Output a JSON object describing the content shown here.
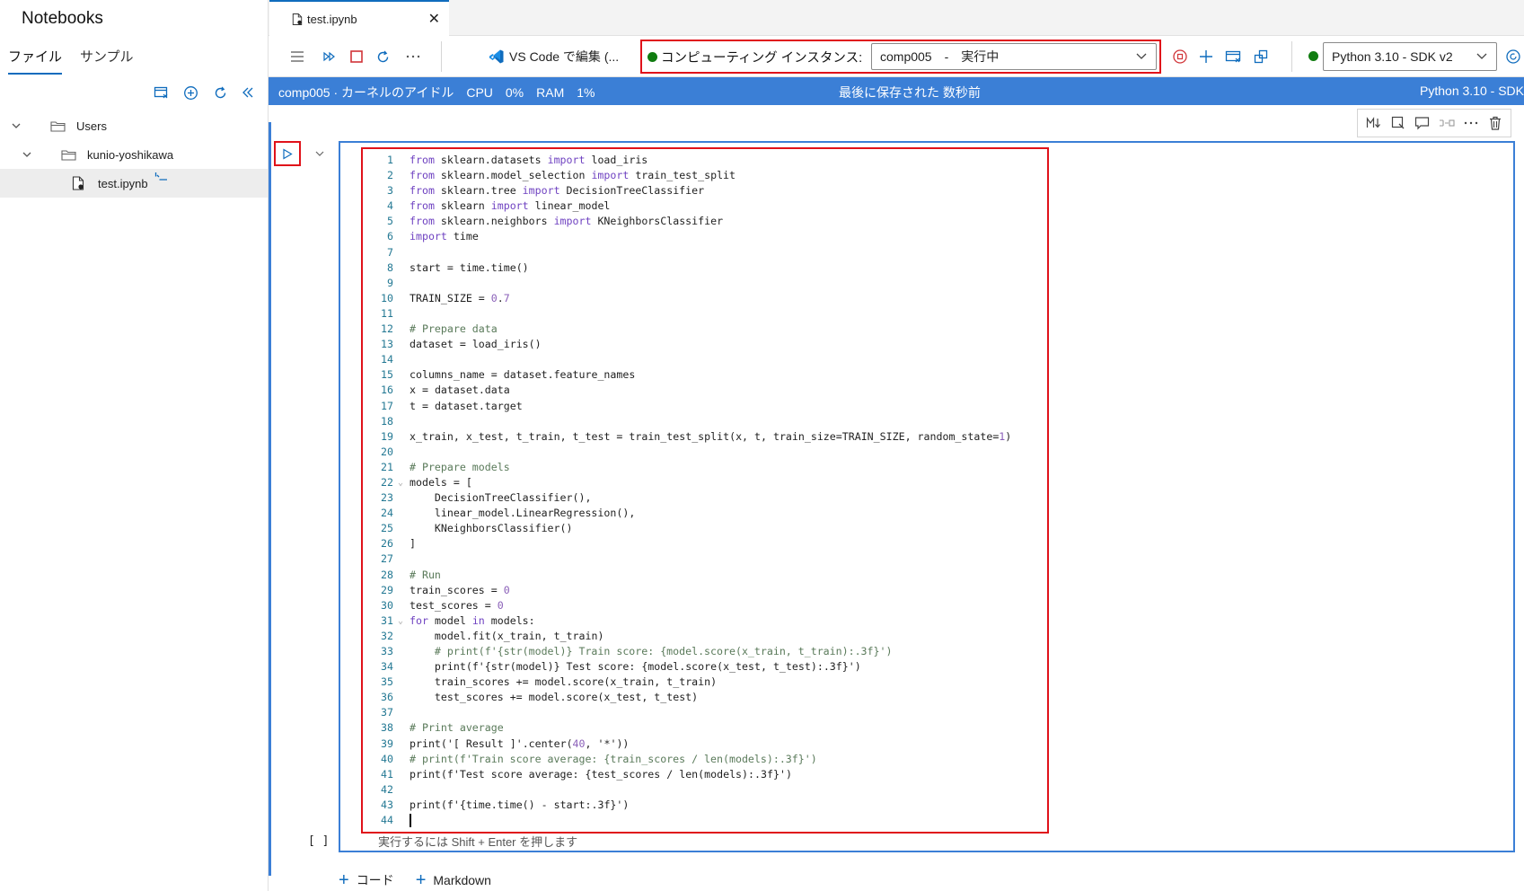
{
  "left_panel": {
    "title": "Notebooks",
    "tabs": [
      {
        "label": "ファイル",
        "active": true
      },
      {
        "label": "サンプル",
        "active": false
      }
    ],
    "tools": [
      "new-file-icon",
      "add-icon",
      "refresh-icon",
      "collapse-panel-icon"
    ],
    "tree": [
      {
        "label": "Users",
        "type": "folder",
        "expanded": true
      },
      {
        "label": "kunio-yoshikawa",
        "type": "folder",
        "expanded": true
      },
      {
        "label": "test.ipynb",
        "type": "notebook",
        "selected": true
      }
    ]
  },
  "tab_strip": {
    "file_tab_label": "test.ipynb",
    "close_glyph": "✕"
  },
  "toolbar": {
    "vscode_label": "VS Code で編集 (...",
    "compute_label": "コンピューティング インスタンス:",
    "compute_value": "comp005　-　実行中",
    "kernel_value": "Python 3.10 - SDK v2",
    "status_color": "#107c10"
  },
  "status_bar": {
    "left": "comp005 · カーネルのアイドル　CPU　0%　RAM　1%",
    "center": "最後に保存された 数秒前",
    "right": "Python 3.10 - SDK"
  },
  "cell": {
    "execution_count": "[ ]",
    "hint": "実行するには Shift + Enter を押します",
    "code_lines": [
      "from sklearn.datasets import load_iris",
      "from sklearn.model_selection import train_test_split",
      "from sklearn.tree import DecisionTreeClassifier",
      "from sklearn import linear_model",
      "from sklearn.neighbors import KNeighborsClassifier",
      "import time",
      "",
      "start = time.time()",
      "",
      "TRAIN_SIZE = 0.7",
      "",
      "# Prepare data",
      "dataset = load_iris()",
      "",
      "columns_name = dataset.feature_names",
      "x = dataset.data",
      "t = dataset.target",
      "",
      "x_train, x_test, t_train, t_test = train_test_split(x, t, train_size=TRAIN_SIZE, random_state=1)",
      "",
      "# Prepare models",
      "models = [",
      "    DecisionTreeClassifier(),",
      "    linear_model.LinearRegression(),",
      "    KNeighborsClassifier()",
      "]",
      "",
      "# Run",
      "train_scores = 0",
      "test_scores = 0",
      "for model in models:",
      "    model.fit(x_train, t_train)",
      "    # print(f'{str(model)} Train score: {model.score(x_train, t_train):.3f}')",
      "    print(f'{str(model)} Test score: {model.score(x_test, t_test):.3f}')",
      "    train_scores += model.score(x_train, t_train)",
      "    test_scores += model.score(x_test, t_test)",
      "",
      "# Print average",
      "print('[ Result ]'.center(40, '*'))",
      "# print(f'Train score average: {train_scores / len(models):.3f}')",
      "print(f'Test score average: {test_scores / len(models):.3f}')",
      "",
      "print(f'{time.time() - start:.3f}')",
      ""
    ],
    "fold_lines": [
      22,
      31
    ]
  },
  "add_buttons": {
    "code_label": "コード",
    "markdown_label": "Markdown"
  },
  "colors": {
    "accent": "#0f6cbd",
    "status_bar": "#3b7fd6",
    "highlight_red": "#e0121a"
  }
}
